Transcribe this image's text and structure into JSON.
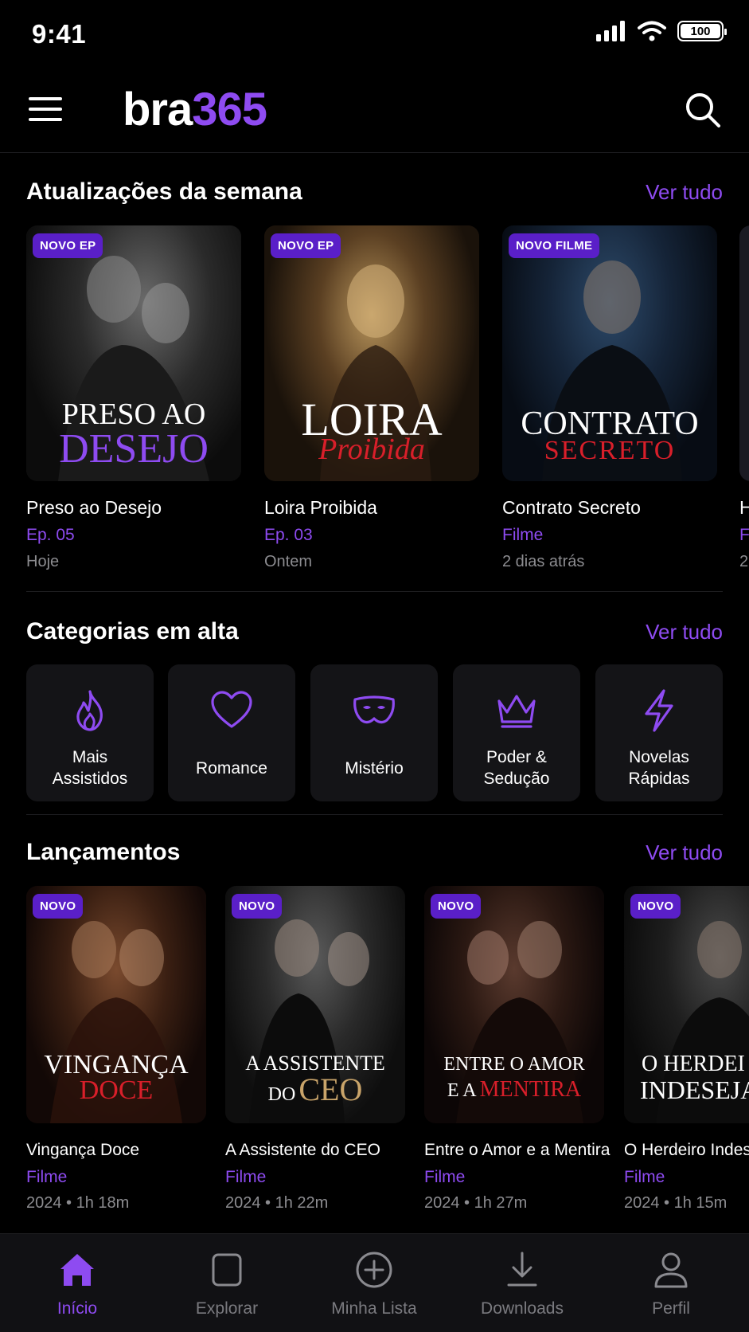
{
  "status_bar": {
    "time": "9:41",
    "battery": "100"
  },
  "header": {
    "logo_part1": "bra",
    "logo_part2": "365"
  },
  "weekly_updates": {
    "title": "Atualizações da semana",
    "see_all": "Ver tudo",
    "items": [
      {
        "badge": "NOVO EP",
        "poster_line1": "PRESO AO",
        "poster_line2": "DESEJO",
        "title": "Preso ao Desejo",
        "meta1": "Ep. 05",
        "meta2": "Hoje"
      },
      {
        "badge": "NOVO EP",
        "poster_line1": "LOIRA",
        "poster_line2": "Proibida",
        "title": "Loira Proibida",
        "meta1": "Ep. 03",
        "meta2": "Ontem"
      },
      {
        "badge": "NOVO FILME",
        "poster_line1": "CONTRATO",
        "poster_line2": "SECRETO",
        "title": "Contrato Secreto",
        "meta1": "Filme",
        "meta2": "2 dias atrás"
      },
      {
        "title": "H",
        "meta1": "F",
        "meta2": "2"
      }
    ]
  },
  "categories": {
    "title": "Categorias em alta",
    "see_all": "Ver tudo",
    "items": [
      {
        "label": "Mais\nAssistidos",
        "icon": "flame-icon"
      },
      {
        "label": "Romance",
        "icon": "heart-icon"
      },
      {
        "label": "Mistério",
        "icon": "mask-icon"
      },
      {
        "label": "Poder &\nSedução",
        "icon": "crown-icon"
      },
      {
        "label": "Novelas\nRápidas",
        "icon": "lightning-icon"
      }
    ]
  },
  "releases": {
    "title": "Lançamentos",
    "see_all": "Ver tudo",
    "items": [
      {
        "badge": "NOVO",
        "poster_line1": "VINGANÇA",
        "poster_line2": "DOCE",
        "title": "Vingança Doce",
        "meta1": "Filme",
        "meta2": "2024 • 1h 18m"
      },
      {
        "badge": "NOVO",
        "poster_line1": "A ASSISTENTE",
        "poster_line2a": "DO",
        "poster_line2b": "CEO",
        "title": "A Assistente do CEO",
        "meta1": "Filme",
        "meta2": "2024 • 1h 22m"
      },
      {
        "badge": "NOVO",
        "poster_line1": "ENTRE O AMOR",
        "poster_line2a": "E A",
        "poster_line2b": "MENTIRA",
        "title": "Entre o Amor e a Mentira",
        "meta1": "Filme",
        "meta2": "2024 • 1h 27m"
      },
      {
        "badge": "NOVO",
        "poster_line1": "O HERDEI",
        "poster_line2": "INDESEJA",
        "title": "O Herdeiro Indese",
        "meta1": "Filme",
        "meta2": "2024 • 1h 15m"
      }
    ]
  },
  "tab_bar": [
    {
      "label": "Início",
      "icon": "home-icon",
      "active": true
    },
    {
      "label": "Explorar",
      "icon": "square-icon"
    },
    {
      "label": "Minha Lista",
      "icon": "plus-circle-icon"
    },
    {
      "label": "Downloads",
      "icon": "download-icon"
    },
    {
      "label": "Perfil",
      "icon": "user-icon"
    }
  ],
  "colors": {
    "accent": "#8e4bf1",
    "badge": "#5a1fc8",
    "background": "#000000",
    "tile": "#141417",
    "muted": "#8c8c90",
    "red": "#d81f2a"
  }
}
